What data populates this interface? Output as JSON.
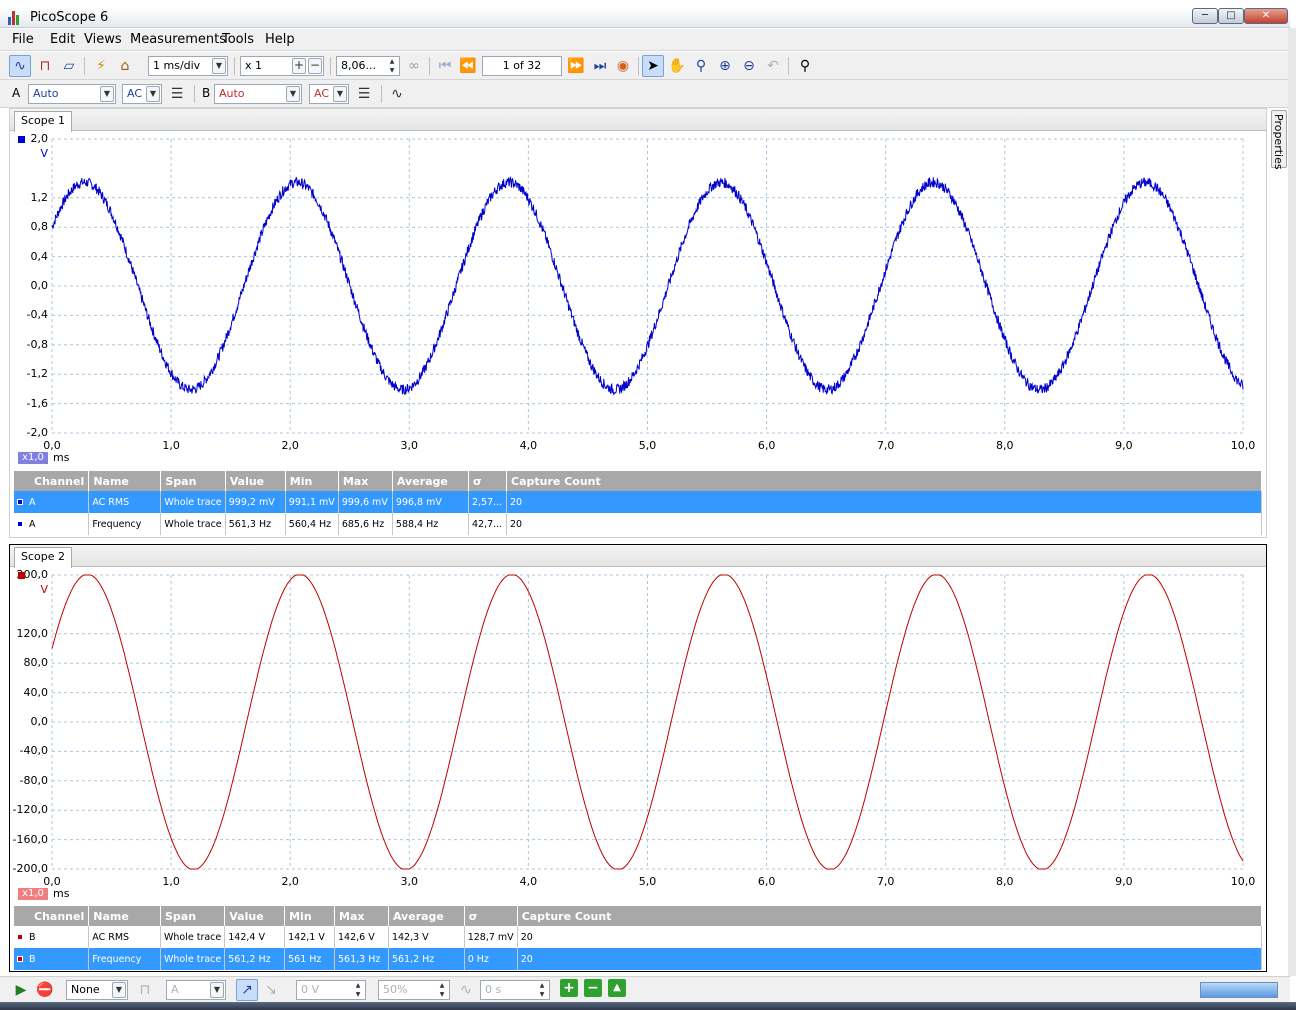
{
  "app": {
    "title": "PicoScope 6"
  },
  "menu": [
    "File",
    "Edit",
    "Views",
    "Measurements",
    "Tools",
    "Help"
  ],
  "toolbar": {
    "timebase": "1 ms/div",
    "zoom": "x 1",
    "samples": "8,06...",
    "buffer": "1 of 32"
  },
  "channels_bar": {
    "a_label": "A",
    "a_range": "Auto",
    "a_coupling": "AC",
    "b_label": "B",
    "b_range": "Auto",
    "b_coupling": "AC"
  },
  "side_tab": "Properties",
  "scopes": [
    {
      "tab": "Scope 1",
      "color": "#0000cc",
      "unit": "V",
      "y_ticks": [
        "2,0",
        "1,2",
        "0,8",
        "0,4",
        "0,0",
        "-0,4",
        "-0,8",
        "-1,2",
        "-1,6",
        "-2,0"
      ],
      "y_values": [
        2.0,
        1.2,
        0.8,
        0.4,
        0.0,
        -0.4,
        -0.8,
        -1.2,
        -1.6,
        -2.0
      ],
      "x_ticks": [
        "0,0",
        "1,0",
        "2,0",
        "3,0",
        "4,0",
        "5,0",
        "6,0",
        "7,0",
        "8,0",
        "9,0",
        "10,0"
      ],
      "x_unit": "ms",
      "zoom_badge": "x1,0",
      "table": {
        "headers": [
          "Channel",
          "Name",
          "Span",
          "Value",
          "Min",
          "Max",
          "Average",
          "σ",
          "Capture Count"
        ],
        "rows": [
          {
            "selected": true,
            "cells": [
              "A",
              "AC RMS",
              "Whole trace",
              "999,2 mV",
              "991,1 mV",
              "999,6 mV",
              "996,8 mV",
              "2,57...",
              "20"
            ]
          },
          {
            "selected": false,
            "cells": [
              "A",
              "Frequency",
              "Whole trace",
              "561,3 Hz",
              "560,4 Hz",
              "685,6 Hz",
              "588,4 Hz",
              "42,7...",
              "20"
            ]
          }
        ]
      }
    },
    {
      "tab": "Scope 2",
      "color": "#c00000",
      "unit": "V",
      "y_ticks": [
        "200,0",
        "120,0",
        "80,0",
        "40,0",
        "0,0",
        "-40,0",
        "-80,0",
        "-120,0",
        "-160,0",
        "-200,0"
      ],
      "y_values": [
        200,
        120,
        80,
        40,
        0,
        -40,
        -80,
        -120,
        -160,
        -200
      ],
      "x_ticks": [
        "0,0",
        "1,0",
        "2,0",
        "3,0",
        "4,0",
        "5,0",
        "6,0",
        "7,0",
        "8,0",
        "9,0",
        "10,0"
      ],
      "x_unit": "ms",
      "zoom_badge": "x1,0",
      "table": {
        "headers": [
          "Channel",
          "Name",
          "Span",
          "Value",
          "Min",
          "Max",
          "Average",
          "σ",
          "Capture Count"
        ],
        "rows": [
          {
            "selected": false,
            "cells": [
              "B",
              "AC RMS",
              "Whole trace",
              "142,4 V",
              "142,1 V",
              "142,6 V",
              "142,3 V",
              "128,7 mV",
              "20"
            ]
          },
          {
            "selected": true,
            "cells": [
              "B",
              "Frequency",
              "Whole trace",
              "561,2 Hz",
              "561 Hz",
              "561,3 Hz",
              "561,2 Hz",
              "0 Hz",
              "20"
            ]
          }
        ]
      }
    }
  ],
  "chart_data": [
    {
      "type": "line",
      "series": [
        {
          "values": {
            "kind": "sine",
            "frequency_hz": 561.3,
            "amplitude": 1.41,
            "offset": 0.0,
            "start_phase_value": 0.8
          }
        }
      ],
      "xlim": [
        0,
        10
      ],
      "ylim": [
        -2.0,
        2.0
      ],
      "grid": true
    },
    {
      "type": "line",
      "series": [
        {
          "values": {
            "kind": "sine",
            "frequency_hz": 561.2,
            "amplitude": 201.0,
            "offset": 0.0,
            "start_phase_value": 100.0
          }
        }
      ],
      "xlim": [
        0,
        10
      ],
      "ylim": [
        -200,
        200
      ],
      "grid": true
    }
  ],
  "statusbar": {
    "trigger_mode": "None",
    "trigger_channel": "A",
    "trigger_level": "0 V",
    "pre_trigger": "50%",
    "delay": "0 s"
  }
}
